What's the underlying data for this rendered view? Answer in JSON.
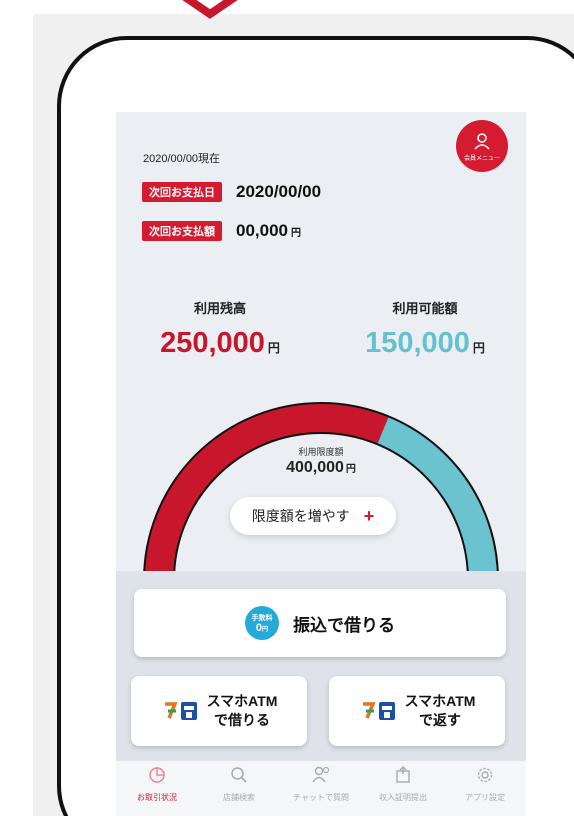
{
  "header": {
    "date_line": "2020/00/00現在",
    "member_menu_label": "会員メニュー"
  },
  "payment": {
    "next_date_tag": "次回お支払日",
    "next_date_value": "2020/00/00",
    "next_amount_tag": "次回お支払額",
    "next_amount_value": "00,000",
    "yen": "円"
  },
  "balance": {
    "used_label": "利用残高",
    "used_value": "250,000",
    "available_label": "利用可能額",
    "available_value": "150,000",
    "yen": "円"
  },
  "gauge": {
    "limit_label": "利用限度額",
    "limit_value": "400,000",
    "yen": "円",
    "used_fraction": 0.625,
    "used_color": "#c8162c",
    "available_color": "#6cc3d0"
  },
  "increase_button": {
    "label": "限度額を増やす",
    "plus": "+"
  },
  "transfer": {
    "fee_badge_top": "手数料",
    "fee_badge_value": "0",
    "fee_badge_unit": "円",
    "label": "振込で借りる"
  },
  "atm_borrow": {
    "line1": "スマホATM",
    "line2": "で借りる"
  },
  "atm_return": {
    "line1": "スマホATM",
    "line2": "で返す"
  },
  "tabbar": {
    "items": [
      {
        "label": "お取引状況",
        "icon": "chart-icon"
      },
      {
        "label": "店舗検索",
        "icon": "search-icon"
      },
      {
        "label": "チャットで質問",
        "icon": "chat-users-icon"
      },
      {
        "label": "収入証明提出",
        "icon": "document-upload-icon"
      },
      {
        "label": "アプリ設定",
        "icon": "gear-icon"
      }
    ]
  },
  "colors": {
    "accent_red": "#d51b2f",
    "teal": "#66c1cf",
    "badge_blue": "#24a9d8"
  }
}
